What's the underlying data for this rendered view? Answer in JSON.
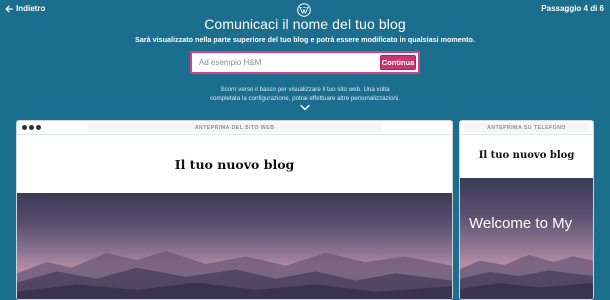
{
  "header": {
    "back_label": "Indietro",
    "step_label": "Passaggio 4 di 6"
  },
  "main": {
    "title": "Comunicaci il nome del tuo blog",
    "subtitle": "Sarà visualizzato nella parte superiore del tuo blog e potrà essere modificato in qualsiasi momento.",
    "input_placeholder": "Ad esempio H&M",
    "input_value": "",
    "continue_label": "Continua",
    "hint_line1": "Scorri verso il basso per visualizzare il tuo sito web. Una volta",
    "hint_line2": "completata la configurazione, potrai effettuare altre personalizzazioni."
  },
  "preview_desktop": {
    "bar_label": "ANTEPRIMA DEL SITO WEB",
    "site_title": "Il tuo nuovo blog"
  },
  "preview_phone": {
    "bar_label": "ANTEPRIMA SU TELEFONO",
    "site_title": "Il tuo nuovo blog",
    "hero_text": "Welcome to My"
  },
  "colors": {
    "background": "#1c6e8f",
    "accent": "#c9356e",
    "accent_border": "#d83f89"
  },
  "icons": {
    "back": "arrow-left-icon",
    "logo": "wordpress-logo-icon",
    "scroll": "chevron-down-icon",
    "window_controls": "dot-icon"
  }
}
